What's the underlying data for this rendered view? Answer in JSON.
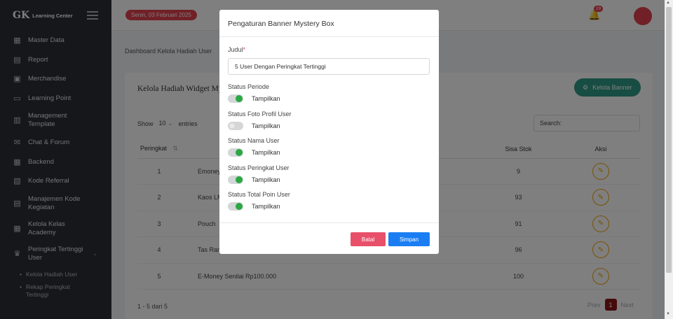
{
  "app": {
    "logo_mark": "GK",
    "logo_text": "Learning Center"
  },
  "topbar": {
    "date": "Senin, 03 Februari 2025",
    "notif_count": "29"
  },
  "sidebar": {
    "items": [
      {
        "label": "Master Data",
        "icon": "database-icon"
      },
      {
        "label": "Report",
        "icon": "report-icon"
      },
      {
        "label": "Merchandise",
        "icon": "merchandise-icon"
      },
      {
        "label": "Learning Point",
        "icon": "monitor-icon"
      },
      {
        "label": "Management Template",
        "icon": "template-icon"
      },
      {
        "label": "Chat & Forum",
        "icon": "chat-icon"
      },
      {
        "label": "Backend",
        "icon": "backend-icon"
      },
      {
        "label": "Kode Referral",
        "icon": "referral-icon"
      },
      {
        "label": "Manajemen Kode Kegiatan",
        "icon": "code-icon"
      },
      {
        "label": "Kelola Kelas Academy",
        "icon": "academy-icon"
      },
      {
        "label": "Peringkat Tertinggi User",
        "icon": "trophy-icon"
      }
    ],
    "sub_items": [
      "Kelola Hadiah User",
      "Rekap Peringkat Tertinggi"
    ]
  },
  "breadcrumb": "Dashboard Kelola Hadiah User",
  "card": {
    "title": "Kelola Hadiah Widget Myst",
    "kelola_button": "Kelola Banner",
    "show_label": "Show",
    "show_value": "10",
    "entries_label": "entries",
    "search_label": "Search:",
    "columns": [
      "Peringkat",
      "",
      "Sisa Stok",
      "Aksi"
    ],
    "rows": [
      {
        "rank": "1",
        "name": "Emoney",
        "stock": "9"
      },
      {
        "rank": "2",
        "name": "Kaos LM",
        "stock": "93"
      },
      {
        "rank": "3",
        "name": "Pouch",
        "stock": "91"
      },
      {
        "rank": "4",
        "name": "Tas Ran",
        "stock": "96"
      },
      {
        "rank": "5",
        "name": "E-Money Senilai Rp100.000",
        "stock": "100"
      }
    ],
    "info": "1 - 5 dari 5",
    "pager": {
      "prev": "Prev",
      "page": "1",
      "next": "Next"
    }
  },
  "modal": {
    "title": "Pengaturan Banner Mystery Box",
    "judul_label": "Judul",
    "judul_required": "*",
    "judul_value": "5 User Dengan Peringkat Tertinggi",
    "statuses": [
      {
        "label": "Status Periode",
        "toggle_label": "Tampilkan",
        "on": true
      },
      {
        "label": "Status Foto Profil User",
        "toggle_label": "Tampilkan",
        "on": false
      },
      {
        "label": "Status Nama User",
        "toggle_label": "Tampilkan",
        "on": true
      },
      {
        "label": "Status Peringkat User",
        "toggle_label": "Tampilkan",
        "on": true
      },
      {
        "label": "Status Total Poin User",
        "toggle_label": "Tampilkan",
        "on": true
      }
    ],
    "cancel": "Batal",
    "save": "Simpan"
  }
}
